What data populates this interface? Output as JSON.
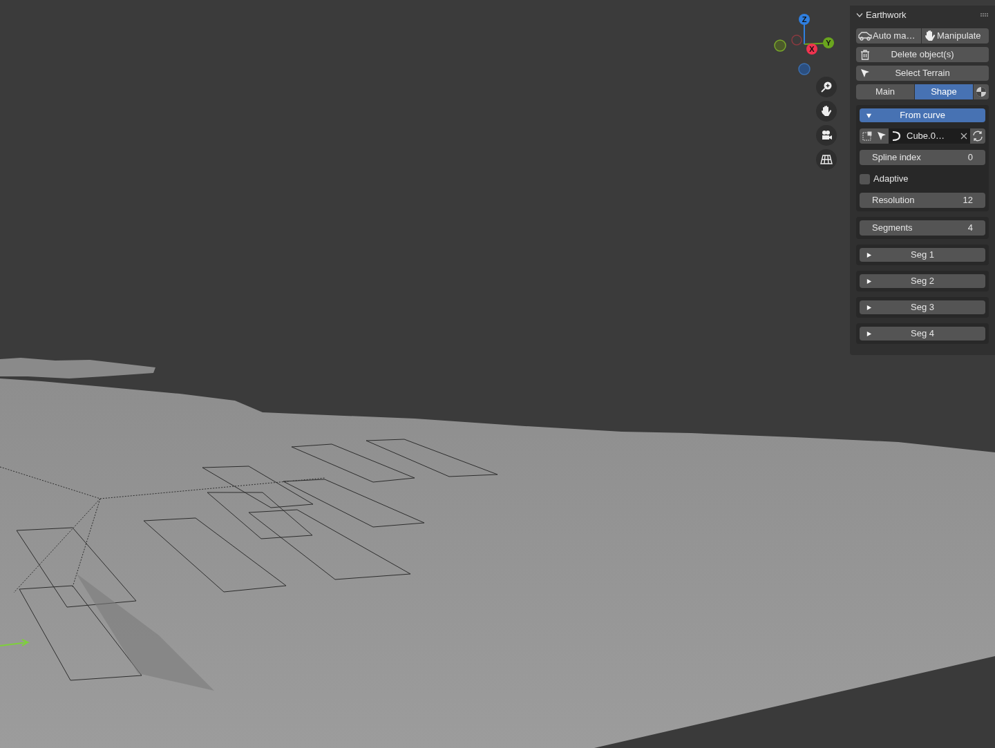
{
  "viewport": {
    "gizmo_axes": [
      {
        "label": "Z",
        "color": "#2f7fe0"
      },
      {
        "label": "Y",
        "color": "#6aa51e"
      },
      {
        "label": "X",
        "color": "#f0334f"
      }
    ]
  },
  "panel": {
    "title": "Earthwork",
    "expanded": true,
    "top_buttons": [
      {
        "label": "Auto ma…",
        "kind": "car"
      },
      {
        "label": "Manipulate",
        "kind": "hand"
      }
    ],
    "actions": [
      {
        "label": "Delete object(s)",
        "kind": "trash"
      },
      {
        "label": "Select Terrain",
        "kind": "cursor"
      }
    ],
    "tabs": [
      {
        "label": "Main",
        "selected": false
      },
      {
        "label": "Shape",
        "selected": true
      }
    ],
    "from_curve": {
      "label": "From curve",
      "expanded": true,
      "object": "Cube.0…",
      "spline_index": {
        "label": "Spline index",
        "value": "0"
      },
      "adaptive": {
        "label": "Adaptive",
        "checked": false
      },
      "resolution": {
        "label": "Resolution",
        "value": "12"
      }
    },
    "segments": {
      "label": "Segments",
      "value": "4"
    },
    "segment_items": [
      {
        "label": "Seg 1",
        "expanded": false
      },
      {
        "label": "Seg 2",
        "expanded": false
      },
      {
        "label": "Seg 3",
        "expanded": false
      },
      {
        "label": "Seg 4",
        "expanded": false
      }
    ]
  }
}
